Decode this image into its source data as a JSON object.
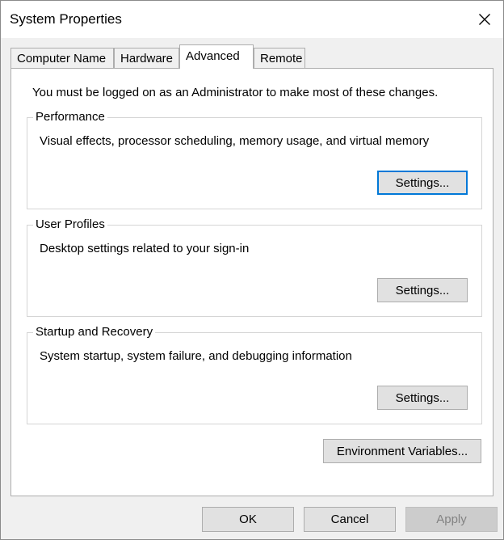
{
  "window": {
    "title": "System Properties"
  },
  "tabs": [
    {
      "label": "Computer Name"
    },
    {
      "label": "Hardware"
    },
    {
      "label": "Advanced"
    },
    {
      "label": "Remote"
    }
  ],
  "advanced": {
    "admin_note": "You must be logged on as an Administrator to make most of these changes.",
    "performance": {
      "title": "Performance",
      "description": "Visual effects, processor scheduling, memory usage, and virtual memory",
      "button": "Settings..."
    },
    "user_profiles": {
      "title": "User Profiles",
      "description": "Desktop settings related to your sign-in",
      "button": "Settings..."
    },
    "startup_recovery": {
      "title": "Startup and Recovery",
      "description": "System startup, system failure, and debugging information",
      "button": "Settings..."
    },
    "env_button": "Environment Variables..."
  },
  "footer": {
    "ok": "OK",
    "cancel": "Cancel",
    "apply": "Apply"
  },
  "colors": {
    "accent": "#0078d7",
    "button_face": "#e1e1e1",
    "disabled_text": "#838383"
  }
}
